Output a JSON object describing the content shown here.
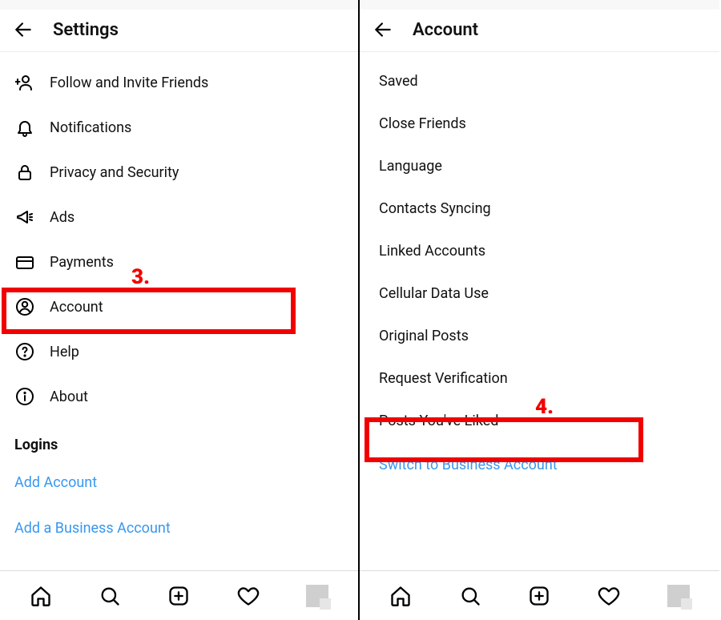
{
  "left": {
    "header_title": "Settings",
    "items": [
      {
        "label": "Follow and Invite Friends"
      },
      {
        "label": "Notifications"
      },
      {
        "label": "Privacy and Security"
      },
      {
        "label": "Ads"
      },
      {
        "label": "Payments"
      },
      {
        "label": "Account"
      },
      {
        "label": "Help"
      },
      {
        "label": "About"
      }
    ],
    "section_heading": "Logins",
    "links": [
      "Add Account",
      "Add a Business Account"
    ],
    "step_marker": "3."
  },
  "right": {
    "header_title": "Account",
    "items": [
      {
        "label": "Saved"
      },
      {
        "label": "Close Friends"
      },
      {
        "label": "Language"
      },
      {
        "label": "Contacts Syncing"
      },
      {
        "label": "Linked Accounts"
      },
      {
        "label": "Cellular Data Use"
      },
      {
        "label": "Original Posts"
      },
      {
        "label": "Request Verification"
      },
      {
        "label": "Posts You've Liked"
      }
    ],
    "links": [
      "Switch to Business Account"
    ],
    "step_marker": "4."
  }
}
